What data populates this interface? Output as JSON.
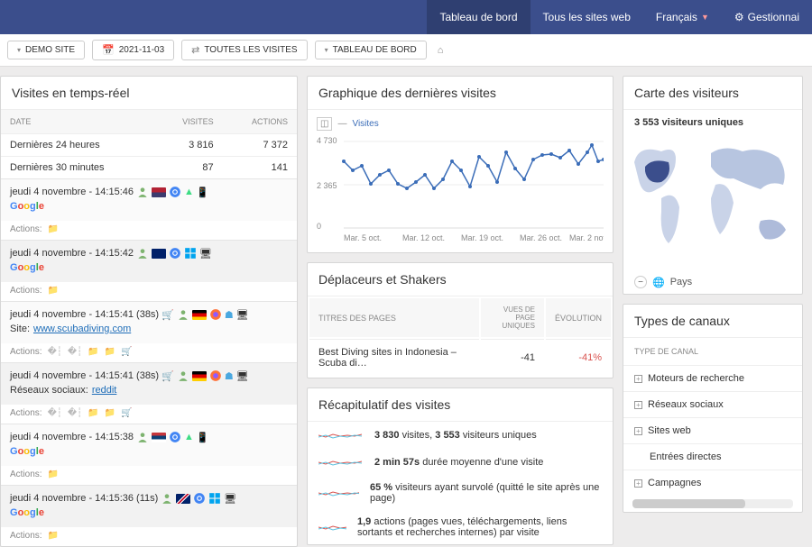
{
  "topbar": {
    "items": [
      {
        "label": "Tableau de bord",
        "active": true
      },
      {
        "label": "Tous les sites web"
      },
      {
        "label": "Français",
        "caret": true
      },
      {
        "label": "Gestionnai"
      }
    ]
  },
  "toolbar": {
    "site": "DEMO SITE",
    "date": "2021-11-03",
    "segment": "TOUTES LES VISITES",
    "dash": "TABLEAU DE BORD"
  },
  "realtime": {
    "title": "Visites en temps-réel",
    "headers": {
      "date": "DATE",
      "visits": "VISITES",
      "actions": "ACTIONS"
    },
    "rows": [
      {
        "label": "Dernières 24 heures",
        "visits": "3 816",
        "actions": "7 372"
      },
      {
        "label": "Dernières 30 minutes",
        "visits": "87",
        "actions": "141"
      }
    ],
    "visits": [
      {
        "time": "jeudi 4 novembre - 14:15:46",
        "flag": "us",
        "browser": "chrome",
        "os": "android",
        "dev": "mobile",
        "ref": "google",
        "actions": [
          "folder"
        ]
      },
      {
        "time": "jeudi 4 novembre - 14:15:42",
        "flag": "au",
        "browser": "chrome",
        "os": "win",
        "dev": "desktop",
        "ref": "google",
        "actions": [
          "folder"
        ]
      },
      {
        "time": "jeudi 4 novembre - 14:15:41 (38s)",
        "flag": "de",
        "browser": "firefox",
        "os": "mac",
        "dev": "desktop",
        "ref_label": "Site:",
        "ref_link": "www.scubadiving.com",
        "cart": true,
        "actions": [
          "m",
          "m",
          "folder",
          "folder",
          "cart"
        ]
      },
      {
        "time": "jeudi 4 novembre - 14:15:41 (38s)",
        "flag": "de",
        "browser": "firefox",
        "os": "mac",
        "dev": "desktop",
        "ref_label": "Réseaux sociaux:",
        "ref_link": "reddit",
        "cart": true,
        "actions": [
          "m",
          "m",
          "folder",
          "folder",
          "cart"
        ]
      },
      {
        "time": "jeudi 4 novembre - 14:15:38",
        "flag": "rs",
        "browser": "chrome",
        "os": "android",
        "dev": "mobile",
        "ref": "google",
        "actions": [
          "folder"
        ]
      },
      {
        "time": "jeudi 4 novembre - 14:15:36 (11s)",
        "flag": "gb",
        "browser": "chrome",
        "os": "win",
        "dev": "desktop",
        "ref": "google",
        "actions": [
          "folder"
        ]
      }
    ],
    "actions_label": "Actions:"
  },
  "graph": {
    "title": "Graphique des dernières visites",
    "legend": "Visites",
    "ymax": "4 730",
    "ymid": "2 365",
    "ymin": "0",
    "xticks": [
      "Mar. 5 oct.",
      "Mar. 12 oct.",
      "Mar. 19 oct.",
      "Mar. 26 oct.",
      "Mar. 2 nov."
    ]
  },
  "chart_data": {
    "type": "line",
    "title": "Graphique des dernières visites",
    "series": [
      {
        "name": "Visites",
        "values": [
          3830,
          3400,
          3650,
          2700,
          3200,
          3550,
          2850,
          2600,
          2900,
          3300,
          2650,
          3050,
          4000,
          3500,
          2750,
          4200,
          3800,
          2950,
          4400,
          3700,
          3100,
          4100,
          4250,
          4300,
          4100,
          4550,
          3900,
          4500,
          4730,
          4000,
          4100
        ]
      }
    ],
    "ylim": [
      0,
      4730
    ],
    "xlabel": "",
    "ylabel": "",
    "xticks": [
      "Mar. 5 oct.",
      "Mar. 12 oct.",
      "Mar. 19 oct.",
      "Mar. 26 oct.",
      "Mar. 2 nov."
    ]
  },
  "movers": {
    "title": "Déplaceurs et Shakers",
    "headers": {
      "page": "TITRES DES PAGES",
      "views": "VUES DE PAGE UNIQUES",
      "evo": "ÉVOLUTION"
    },
    "rows": [
      {
        "page": "Best Diving sites in Indonesia – Scuba di…",
        "views": "-41",
        "evo": "-41%"
      }
    ]
  },
  "recap": {
    "title": "Récapitulatif des visites",
    "rows": [
      {
        "pre": "3 830",
        "t1": "visites, ",
        "b2": "3 553",
        "t2": " visiteurs uniques"
      },
      {
        "pre": "2 min 57s",
        "t1": " durée moyenne d'une visite"
      },
      {
        "pre": "65 %",
        "t1": " visiteurs ayant survolé (quitté le site après une page)"
      },
      {
        "pre": "1,9",
        "t1": " actions (pages vues, téléchargements, liens sortants et recherches internes) par visite"
      }
    ]
  },
  "map": {
    "title": "Carte des visiteurs",
    "count": "3 553 visiteurs uniques",
    "footer": "Pays"
  },
  "channels": {
    "title": "Types de canaux",
    "header": "TYPE DE CANAL",
    "items": [
      {
        "label": "Moteurs de recherche",
        "exp": true
      },
      {
        "label": "Réseaux sociaux",
        "exp": true
      },
      {
        "label": "Sites web",
        "exp": true
      },
      {
        "label": "Entrées directes",
        "exp": false
      },
      {
        "label": "Campagnes",
        "exp": true
      }
    ]
  }
}
